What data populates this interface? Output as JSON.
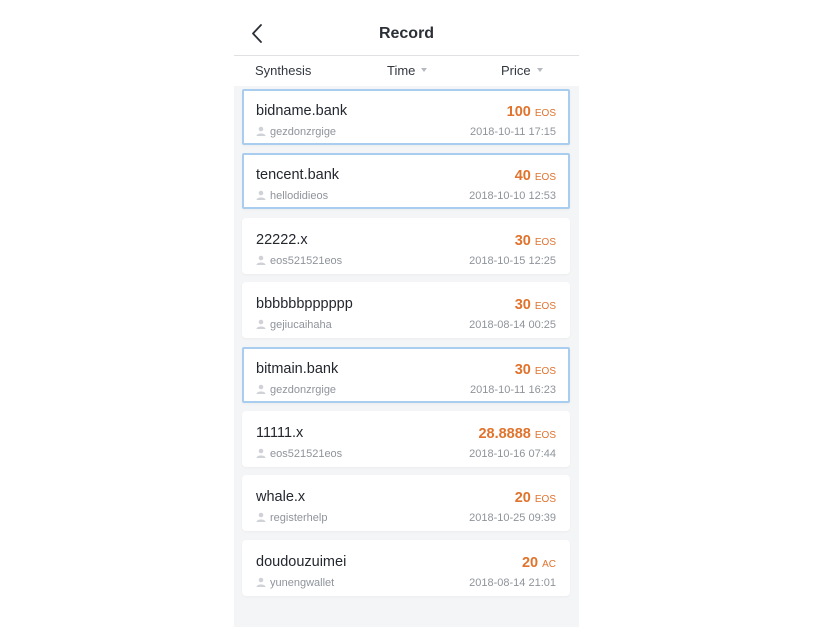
{
  "header": {
    "title": "Record"
  },
  "sort": {
    "synthesis": "Synthesis",
    "time": "Time",
    "price": "Price"
  },
  "records": [
    {
      "name": "bidname.bank",
      "amount": "100",
      "unit": "EOS",
      "user": "gezdonzrgige",
      "date": "2018-10-11 17:15",
      "highlighted": true
    },
    {
      "name": "tencent.bank",
      "amount": "40",
      "unit": "EOS",
      "user": "hellodidieos",
      "date": "2018-10-10 12:53",
      "highlighted": true
    },
    {
      "name": "22222.x",
      "amount": "30",
      "unit": "EOS",
      "user": "eos521521eos",
      "date": "2018-10-15 12:25",
      "highlighted": false
    },
    {
      "name": "bbbbbbpppppp",
      "amount": "30",
      "unit": "EOS",
      "user": "gejiucaihaha",
      "date": "2018-08-14 00:25",
      "highlighted": false
    },
    {
      "name": "bitmain.bank",
      "amount": "30",
      "unit": "EOS",
      "user": "gezdonzrgige",
      "date": "2018-10-11 16:23",
      "highlighted": true
    },
    {
      "name": "11111.x",
      "amount": "28.8888",
      "unit": "EOS",
      "user": "eos521521eos",
      "date": "2018-10-16 07:44",
      "highlighted": false
    },
    {
      "name": "whale.x",
      "amount": "20",
      "unit": "EOS",
      "user": "registerhelp",
      "date": "2018-10-25 09:39",
      "highlighted": false
    },
    {
      "name": "doudouzuimei",
      "amount": "20",
      "unit": "AC",
      "user": "yunengwallet",
      "date": "2018-08-14 21:01",
      "highlighted": false
    }
  ],
  "colors": {
    "price": "#e0732d",
    "highlight_border": "#a9cdef",
    "background": "#f4f5f7"
  }
}
